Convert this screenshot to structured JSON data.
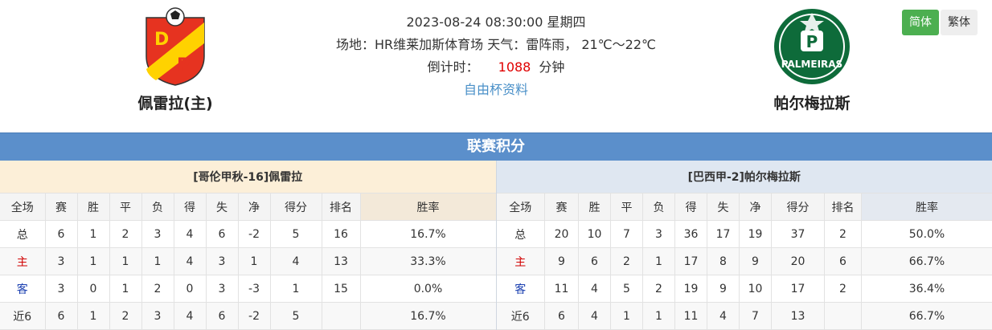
{
  "header": {
    "datetime": "2023-08-24 08:30:00 星期四",
    "venue_weather": "场地：HR维莱加斯体育场 天气：雷阵雨， 21℃～22℃",
    "countdown_label": "倒计时：",
    "countdown_value": "1088",
    "countdown_unit": "分钟",
    "cup_link": "自由杯资料"
  },
  "home_team": {
    "name": "佩雷拉(主)",
    "logo_letters": "DP"
  },
  "away_team": {
    "name": "帕尔梅拉斯",
    "logo_text": "PALMEIRAS"
  },
  "lang": {
    "simplified": "简体",
    "traditional": "繁体"
  },
  "section_title": "联赛积分",
  "columns": [
    "全场",
    "赛",
    "胜",
    "平",
    "负",
    "得",
    "失",
    "净",
    "得分",
    "排名",
    "胜率"
  ],
  "left_table": {
    "title": "[哥伦甲秋-16]佩雷拉",
    "rows": [
      [
        "总",
        "6",
        "1",
        "2",
        "3",
        "4",
        "6",
        "-2",
        "5",
        "16",
        "16.7%"
      ],
      [
        "主",
        "3",
        "1",
        "1",
        "1",
        "4",
        "3",
        "1",
        "4",
        "13",
        "33.3%"
      ],
      [
        "客",
        "3",
        "0",
        "1",
        "2",
        "0",
        "3",
        "-3",
        "1",
        "15",
        "0.0%"
      ],
      [
        "近6",
        "6",
        "1",
        "2",
        "3",
        "4",
        "6",
        "-2",
        "5",
        "",
        "16.7%"
      ]
    ]
  },
  "right_table": {
    "title": "[巴西甲-2]帕尔梅拉斯",
    "rows": [
      [
        "总",
        "20",
        "10",
        "7",
        "3",
        "36",
        "17",
        "19",
        "37",
        "2",
        "50.0%"
      ],
      [
        "主",
        "9",
        "6",
        "2",
        "1",
        "17",
        "8",
        "9",
        "20",
        "6",
        "66.7%"
      ],
      [
        "客",
        "11",
        "4",
        "5",
        "2",
        "19",
        "9",
        "10",
        "17",
        "2",
        "36.4%"
      ],
      [
        "近6",
        "6",
        "4",
        "1",
        "1",
        "11",
        "4",
        "7",
        "13",
        "",
        "66.7%"
      ]
    ]
  },
  "colors": {
    "section_bar": "#5b8fcb",
    "lang_active": "#4caf50",
    "home_logo_red": "#e63320",
    "home_logo_yellow": "#ffd200",
    "away_logo_green": "#0e6b3a",
    "countdown": "#e00000",
    "link": "#4a90c8"
  }
}
